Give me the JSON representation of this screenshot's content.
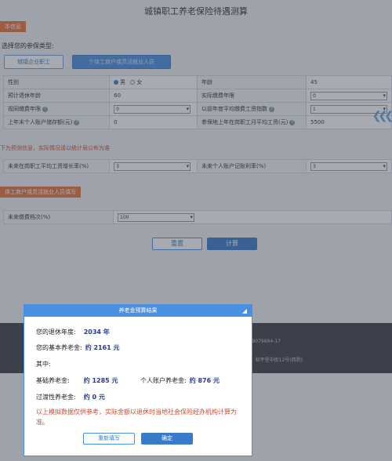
{
  "page": {
    "title": "城镇职工养老保险待遇测算",
    "section_basic": "本信息",
    "choose_type_label": "选择您的参保类型:",
    "type_options": [
      "城镇企业职工",
      "个体工商户或灵活就业人员"
    ],
    "note_projection": "下为预测信息，实际情况请以统计局公布为准",
    "section_self": "体工商户或灵活就业人员填写",
    "reset_label": "重置",
    "calc_label": "计算"
  },
  "form": {
    "gender_label": "性别",
    "gender_male": "男",
    "gender_female": "女",
    "age_label": "年龄",
    "age_value": "45",
    "retire_age_label": "预计退休年龄",
    "retire_age_value": "60",
    "actual_years_label": "实际缴费年限",
    "actual_years_value": "0",
    "deemed_years_label": "视同缴费年限",
    "deemed_years_value": "0",
    "prev_index_label": "以前年度平均缴费工资指数",
    "prev_index_value": "1",
    "balance_label": "上年末个人账户储存额(元)",
    "balance_value": "0",
    "avg_wage_label": "参保地上年在岗职工月平均工资(元)",
    "avg_wage_value": "5500",
    "wage_growth_label": "未来在岗职工平均工资增长率(%)",
    "wage_growth_value": "3",
    "interest_label": "未来个人账户记账利率(%)",
    "interest_value": "3",
    "contrib_base_label": "未来缴费档次(%)",
    "contrib_base_value": "100"
  },
  "footer": {
    "line1": "09079694-17",
    "line2": "和平里中街12号(西院)"
  },
  "modal": {
    "title": "养老金预算结果",
    "retire_year_label": "您的退休年度:",
    "retire_year_value": "2034 年",
    "basic_pension_label": "您的基本养老金:",
    "basic_pension_value": "约 2161 元",
    "among_label": "其中:",
    "base_pension_label": "基础养老金:",
    "base_pension_value": "约 1285 元",
    "personal_pension_label": "个人账户养老金:",
    "personal_pension_value": "约 876 元",
    "transition_label": "过渡性养老金:",
    "transition_value": "约 0 元",
    "note": "以上模拟数据仅供参考，实际金额以退休时当地社会保险经办机构计算为准。",
    "refill_label": "重新填写",
    "confirm_label": "确定"
  }
}
